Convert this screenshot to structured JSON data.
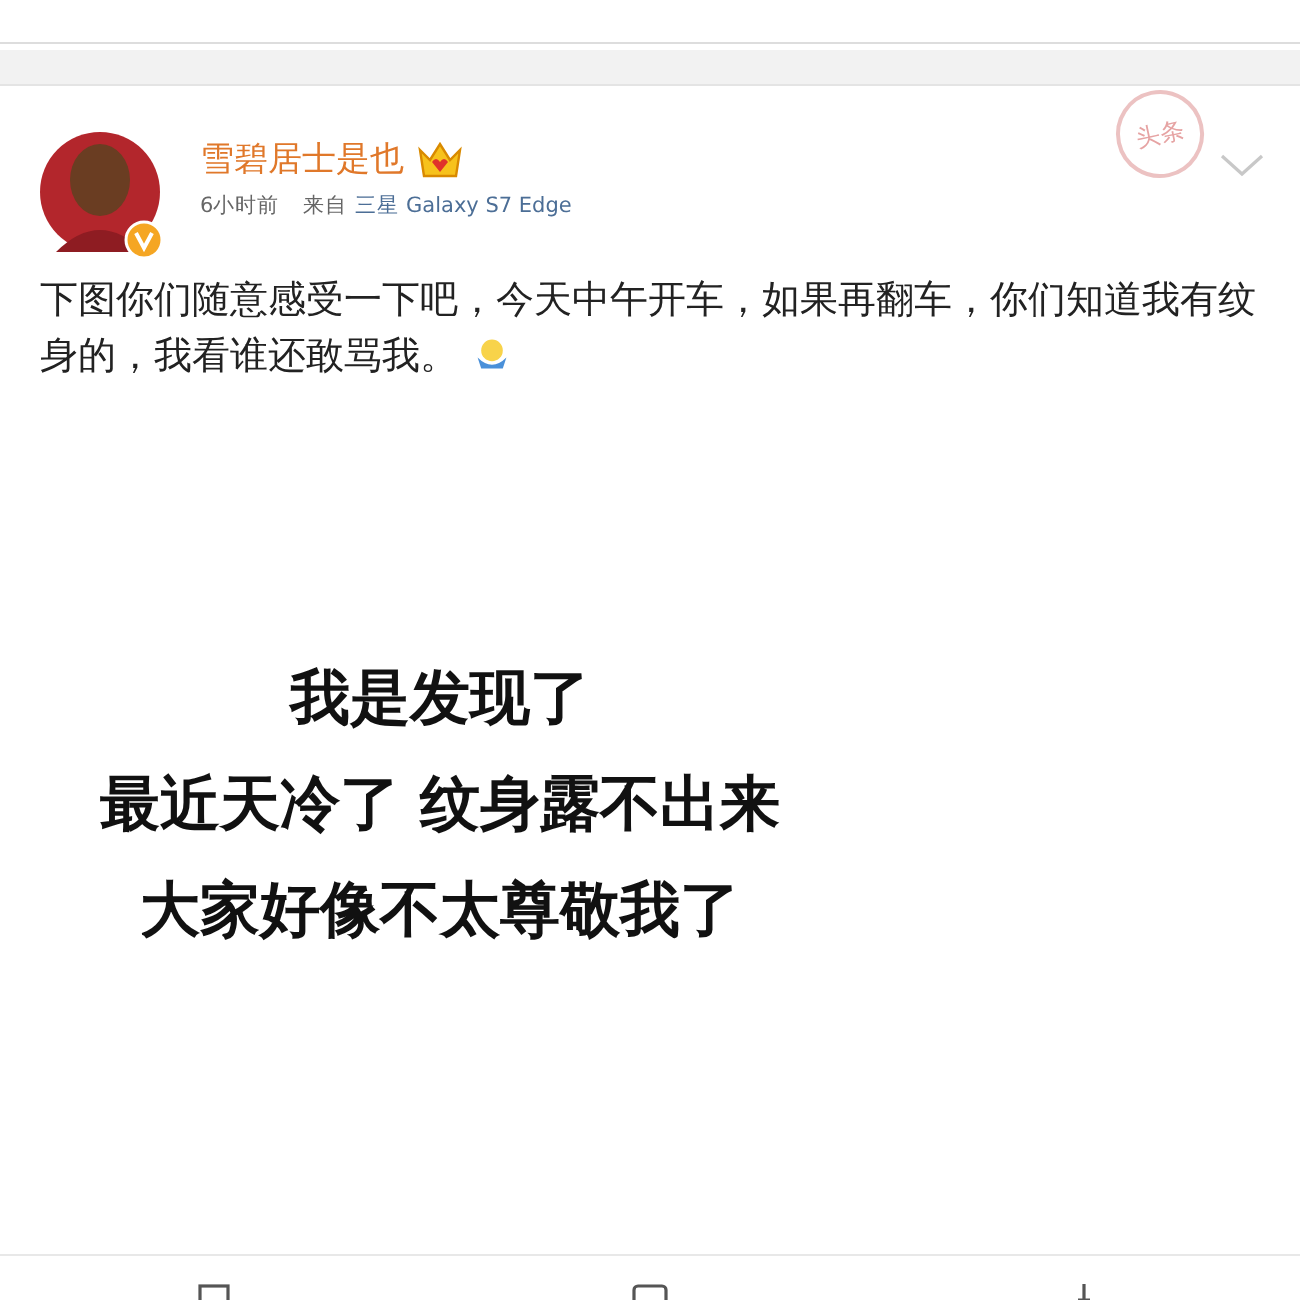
{
  "post": {
    "author": "雪碧居士是也",
    "verified": true,
    "time": "6小时前",
    "source_prefix": "来自",
    "source": "三星 Galaxy S7 Edge",
    "badge": "头条",
    "text": "下图你们随意感受一下吧，今天中午开车，如果再翻车，你们知道我有纹身的，我看谁还敢骂我。",
    "image_lines": [
      "我是发现了",
      "最近天冷了 纹身露不出来",
      "大家好像不太尊敬我了"
    ]
  }
}
